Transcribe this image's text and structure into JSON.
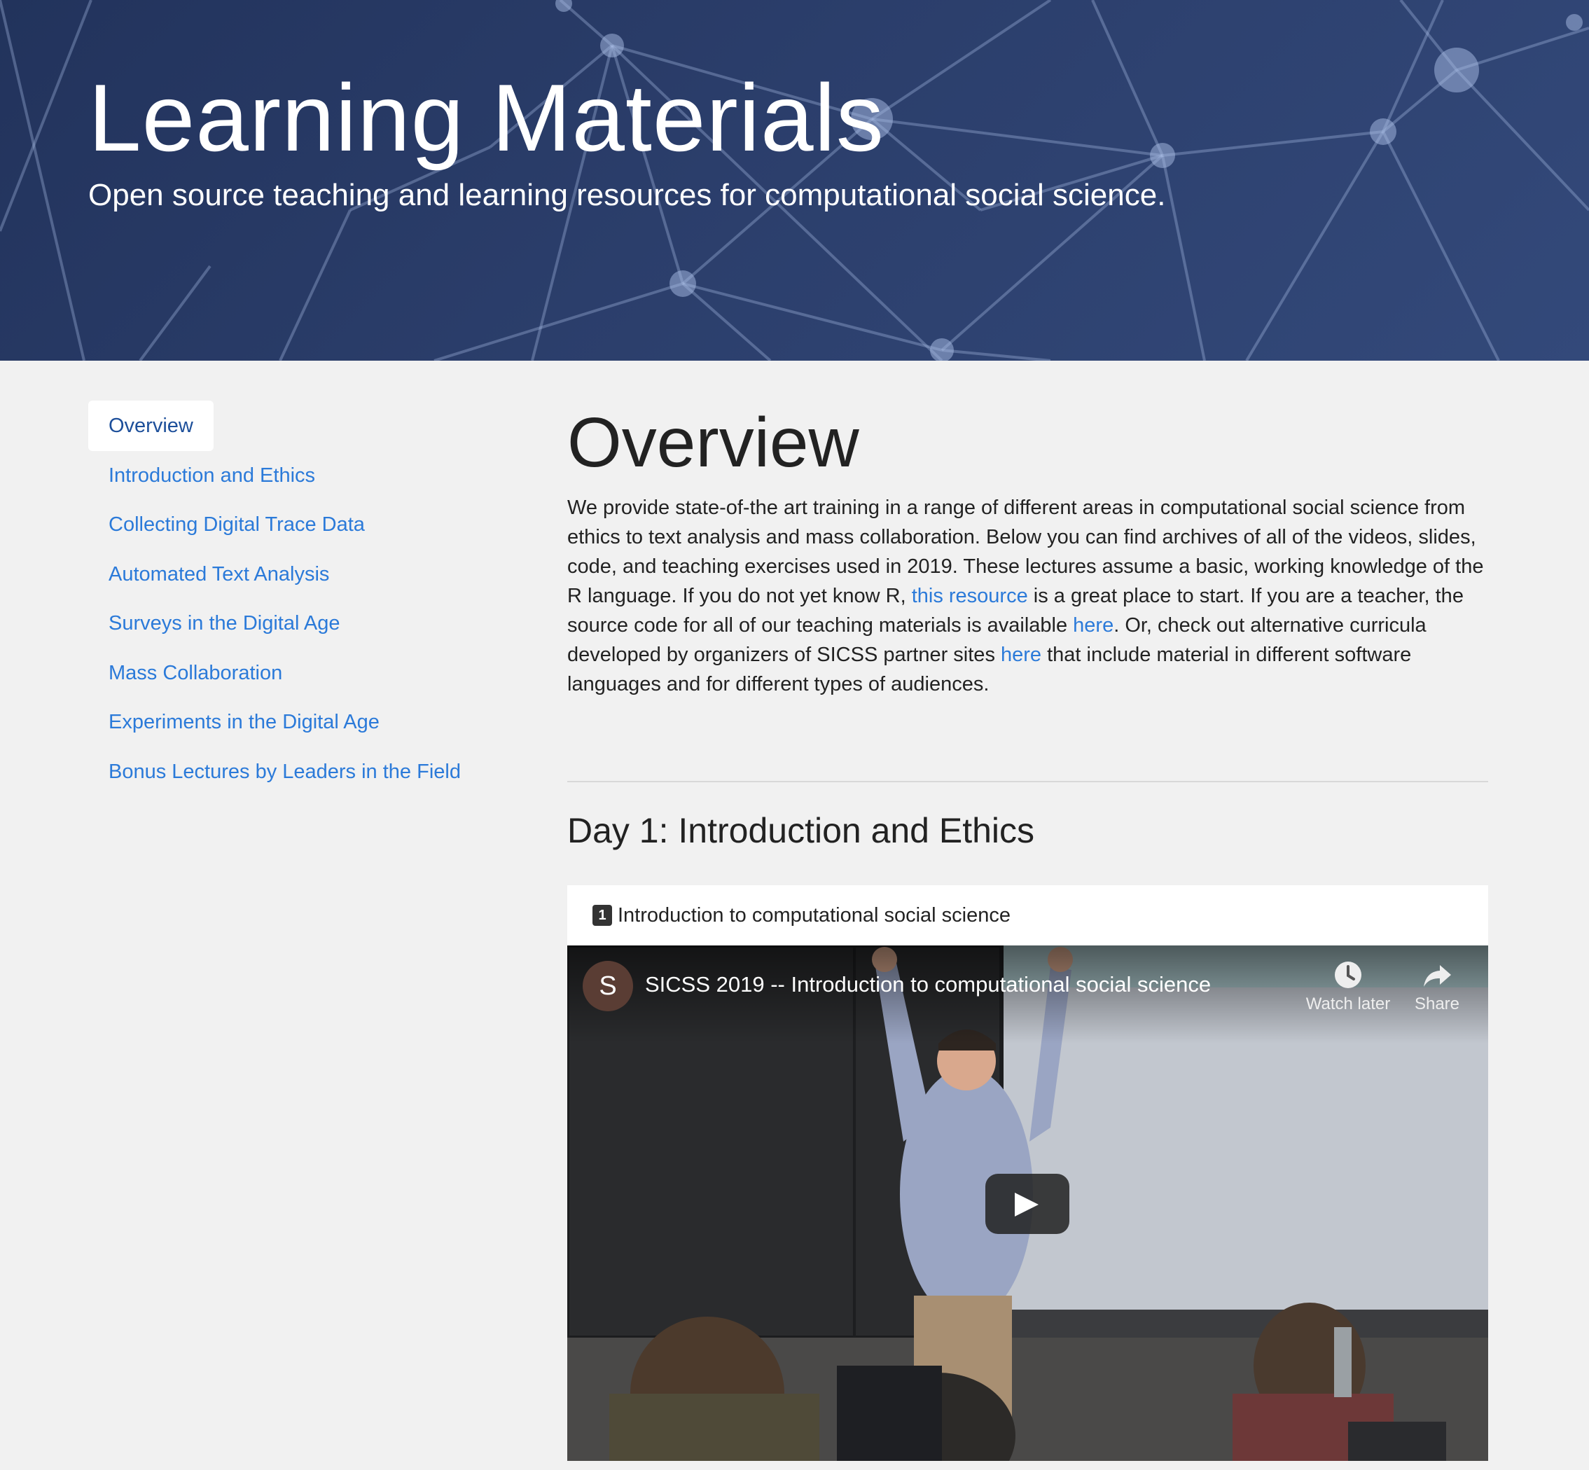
{
  "hero": {
    "title": "Learning Materials",
    "subtitle": "Open source teaching and learning resources for computational social science."
  },
  "sidebar": {
    "items": [
      {
        "label": "Overview",
        "active": true
      },
      {
        "label": "Introduction and Ethics"
      },
      {
        "label": "Collecting Digital Trace Data"
      },
      {
        "label": "Automated Text Analysis"
      },
      {
        "label": "Surveys in the Digital Age"
      },
      {
        "label": "Mass Collaboration"
      },
      {
        "label": "Experiments in the Digital Age"
      },
      {
        "label": "Bonus Lectures by Leaders in the Field"
      }
    ]
  },
  "main": {
    "heading": "Overview",
    "intro": {
      "part1": "We provide state-of-the art training in a range of different areas in computational social science from ethics to text analysis and mass collaboration. Below you can find archives of all of the videos, slides, code, and teaching exercises used in 2019. These lectures assume a basic, working knowledge of the R language. If you do not yet know R, ",
      "link1": "this resource",
      "part2": " is a great place to start. If you are a teacher, the source code for all of our teaching materials is available ",
      "link2": "here",
      "part3": ". Or, check out alternative curricula developed by organizers of SICSS partner sites ",
      "link3": "here",
      "part4": " that include material in different software languages and for different types of audiences."
    },
    "day1": {
      "title": "Day 1: Introduction and Ethics",
      "lecture": {
        "number": "1",
        "title": "Introduction to computational social science",
        "video": {
          "channel_initial": "S",
          "title": "SICSS 2019 -- Introduction to computational social science",
          "watch_later": "Watch later",
          "share": "Share"
        }
      }
    }
  },
  "colors": {
    "hero_bg": "#2b3e6b",
    "link": "#2b7ad9",
    "page_bg": "#f1f1f1"
  }
}
